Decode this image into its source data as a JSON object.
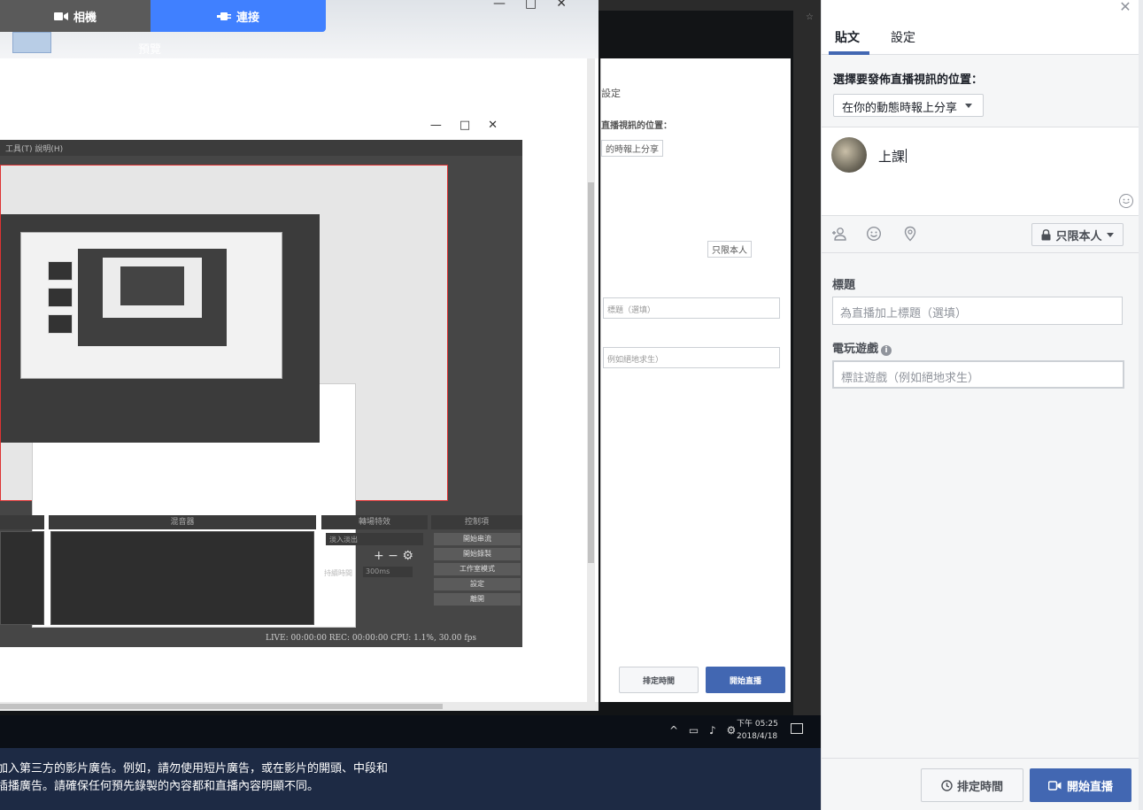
{
  "preview": {
    "tabs": [
      {
        "label": "相機",
        "icon": "video-camera-icon"
      },
      {
        "label": "連接",
        "icon": "plug-icon"
      }
    ],
    "active_tab": "連接",
    "section_label": "預覽",
    "mirror": {
      "tab_label": "設定",
      "location_label": "直播視訊的位置：",
      "location_value": "的時報上分享",
      "privacy": "只限本人",
      "title_placeholder": "標題（選填）",
      "game_placeholder": "例如絕地求生）",
      "schedule": "排定時間",
      "golive": "開始直播"
    },
    "obs": {
      "menu": "工具(T)  說明(H)",
      "docks": [
        "混音器",
        "轉場特效",
        "控制項"
      ],
      "controls": [
        "開始串流",
        "開始錄製",
        "工作室模式",
        "設定",
        "離開"
      ],
      "transition": "淡入淡出",
      "duration_label": "持續時間",
      "duration_value": "300ms",
      "status": "LIVE: 00:00:00    REC: 00:00:00    CPU: 1.1%, 30.00 fps"
    },
    "taskbar": {
      "time": "下午 05:25",
      "date": "2018/4/18"
    }
  },
  "notice": {
    "line1": "加入第三方的影片廣告。例如，請勿使用短片廣告，或在影片的開頭、中段和",
    "line2": "插播廣告。請確保任何預先錄製的內容都和直播內容明顯不同。"
  },
  "panel": {
    "tabs": [
      "貼文",
      "設定"
    ],
    "active_tab": "貼文",
    "location_label": "選擇要發佈直播視訊的位置：",
    "location_value": "在你的動態時報上分享",
    "post_text": "上課",
    "privacy_label": "只限本人",
    "title_label": "標題",
    "title_placeholder": "為直播加上標題（選填）",
    "game_label": "電玩遊戲",
    "game_placeholder": "標註遊戲（例如絕地求生）",
    "schedule_label": "排定時間",
    "golive_label": "開始直播",
    "accent": "#4267b2"
  }
}
